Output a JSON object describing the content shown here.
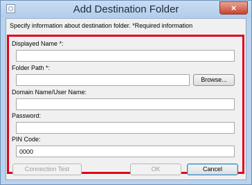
{
  "window": {
    "title": "Add Destination Folder",
    "close_glyph": "×"
  },
  "dialog": {
    "description": "Specify information about destination folder. *Required information",
    "fields": {
      "displayed_name": {
        "label": "Displayed Name *:",
        "value": ""
      },
      "folder_path": {
        "label": "Folder Path *:",
        "value": ""
      },
      "domain_user": {
        "label": "Domain Name/User Name:",
        "value": ""
      },
      "password": {
        "label": "Password:",
        "value": ""
      },
      "pin_code": {
        "label": "PIN Code:",
        "value": "0000"
      }
    },
    "browse_label": "Browse...",
    "highlight_color": "#e0001b"
  },
  "buttons": {
    "connection_test": "Connection Test",
    "ok": "OK",
    "cancel": "Cancel"
  }
}
